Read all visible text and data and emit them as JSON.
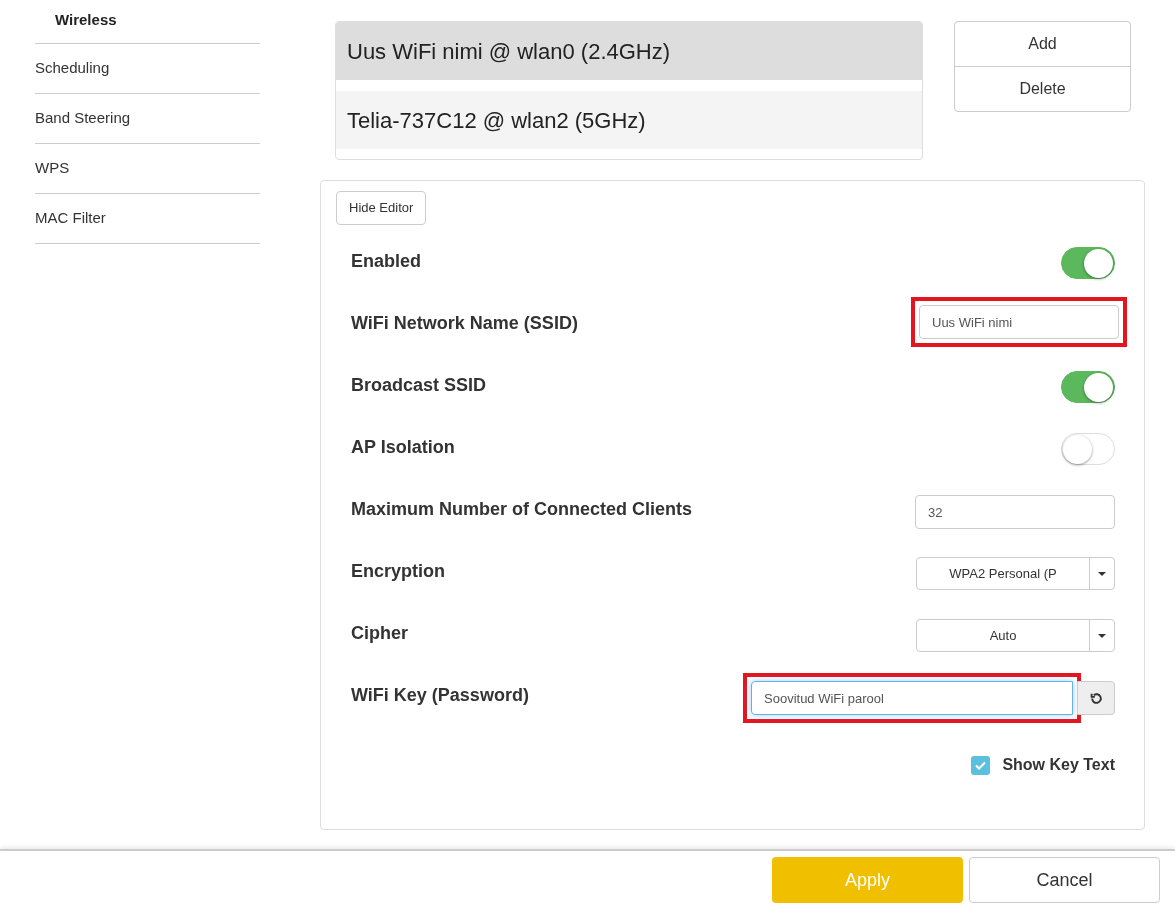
{
  "sidebar": {
    "items": [
      {
        "label": "Wireless",
        "selected": true
      },
      {
        "label": "Scheduling",
        "selected": false
      },
      {
        "label": "Band Steering",
        "selected": false
      },
      {
        "label": "WPS",
        "selected": false
      },
      {
        "label": "MAC Filter",
        "selected": false
      }
    ]
  },
  "networks": [
    {
      "label": "Uus WiFi nimi @ wlan0 (2.4GHz)",
      "selected": true
    },
    {
      "label": "Telia-737C12 @ wlan2 (5GHz)",
      "selected": false
    }
  ],
  "network_actions": [
    "Add",
    "Delete"
  ],
  "editor": {
    "toggle_button": "Hide Editor",
    "rows": [
      {
        "kind": "toggle",
        "label": "Enabled",
        "on": true
      },
      {
        "kind": "text",
        "label": "WiFi Network Name (SSID)",
        "value": "Uus WiFi nimi",
        "highlighted": true
      },
      {
        "kind": "toggle",
        "label": "Broadcast SSID",
        "on": true
      },
      {
        "kind": "toggle",
        "label": "AP Isolation",
        "on": false
      },
      {
        "kind": "text",
        "label": "Maximum Number of Connected Clients",
        "value": "32",
        "highlighted": false
      },
      {
        "kind": "select",
        "label": "Encryption",
        "value": "WPA2 Personal (P"
      },
      {
        "kind": "select",
        "label": "Cipher",
        "value": "Auto"
      },
      {
        "kind": "password",
        "label": "WiFi Key (Password)",
        "value": "Soovitud WiFi parool",
        "highlighted": true
      }
    ],
    "show_key": {
      "label": "Show Key Text",
      "checked": true
    }
  },
  "footer": {
    "apply": "Apply",
    "cancel": "Cancel"
  }
}
